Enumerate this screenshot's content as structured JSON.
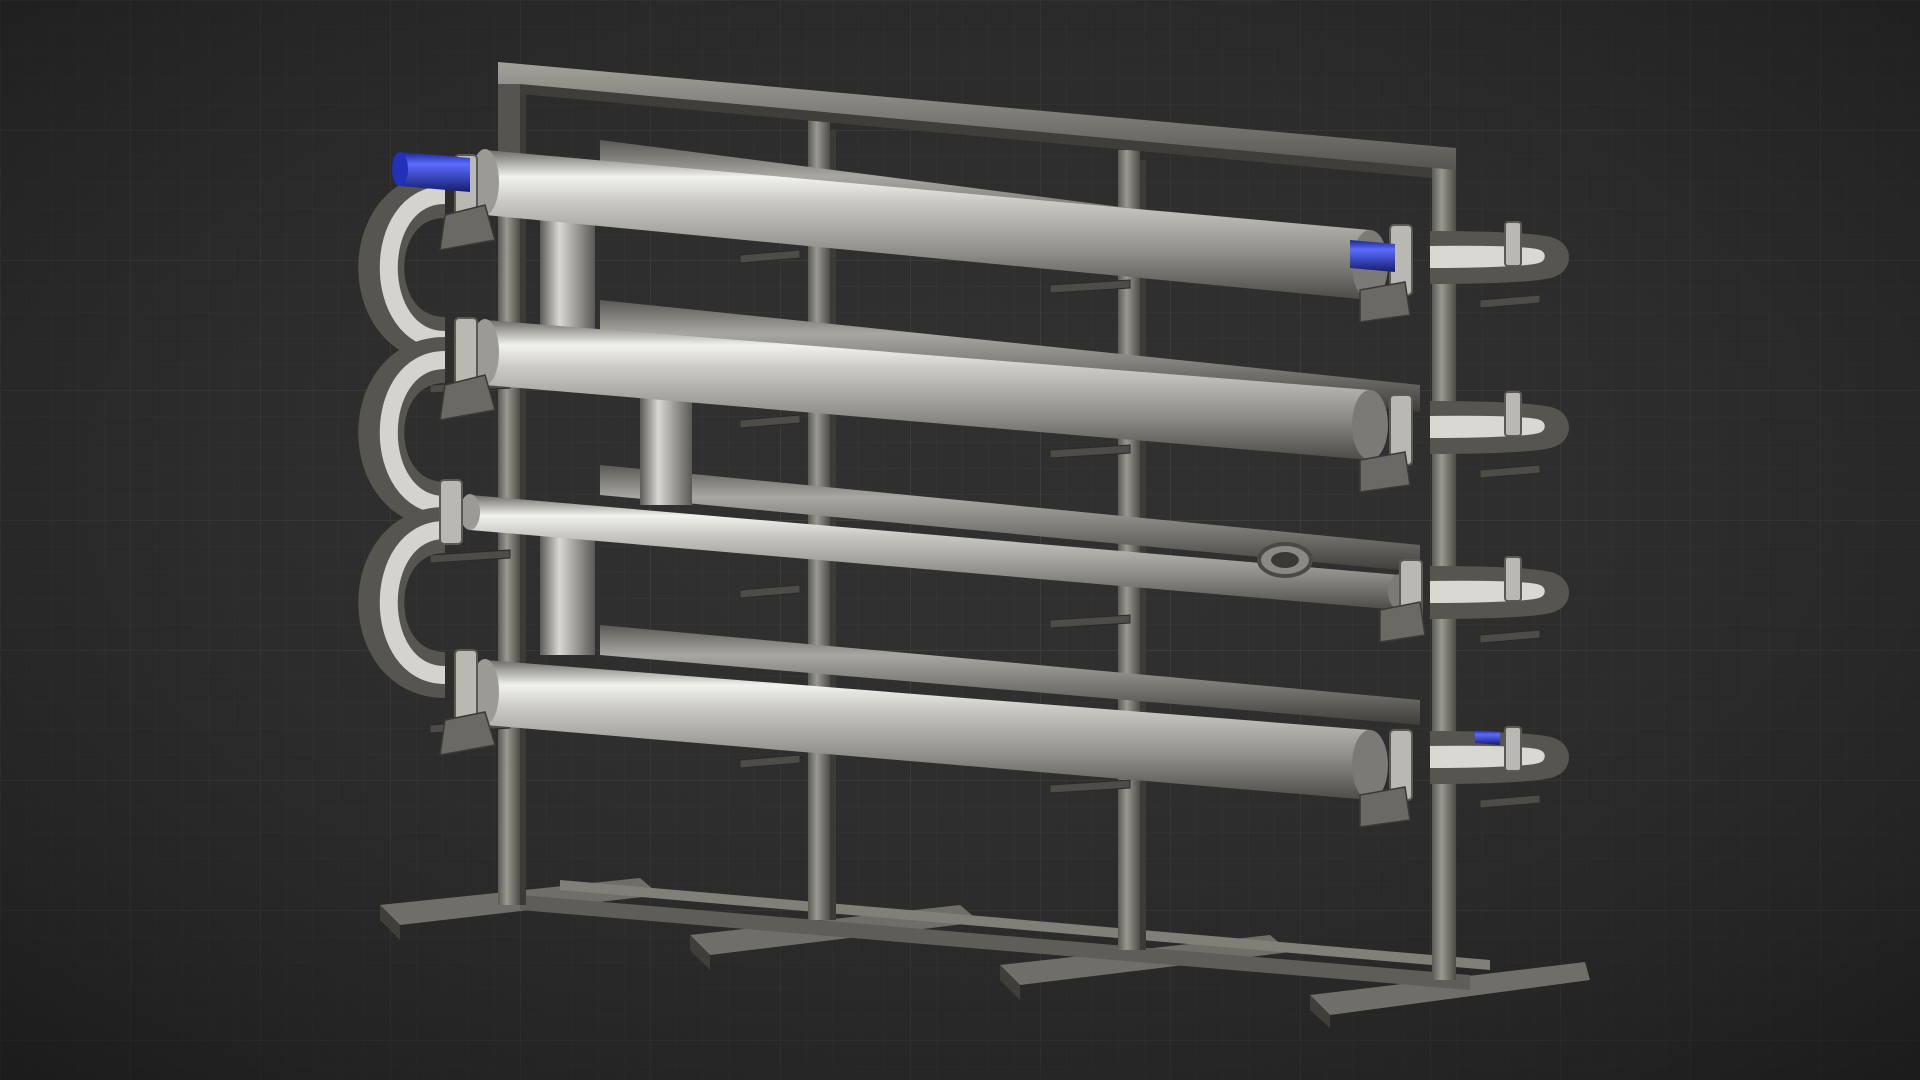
{
  "background": {
    "base_color": "#2f2f2f",
    "vignette_color": "#1e1e1e",
    "grid_color": "#3b3b3b",
    "grid_major_color": "#444444"
  },
  "materials": {
    "steel_light": "#e6e6e2",
    "steel_mid": "#a9a8a3",
    "steel_dark": "#5d5c58",
    "frame_light": "#8f8d86",
    "frame_dark": "#4a4944",
    "inlet_blue": "#2a39c8",
    "inlet_blue_light": "#5c6cff"
  },
  "model": {
    "pass_count": 4,
    "frame_columns": 4,
    "inlet_ports": 2
  }
}
